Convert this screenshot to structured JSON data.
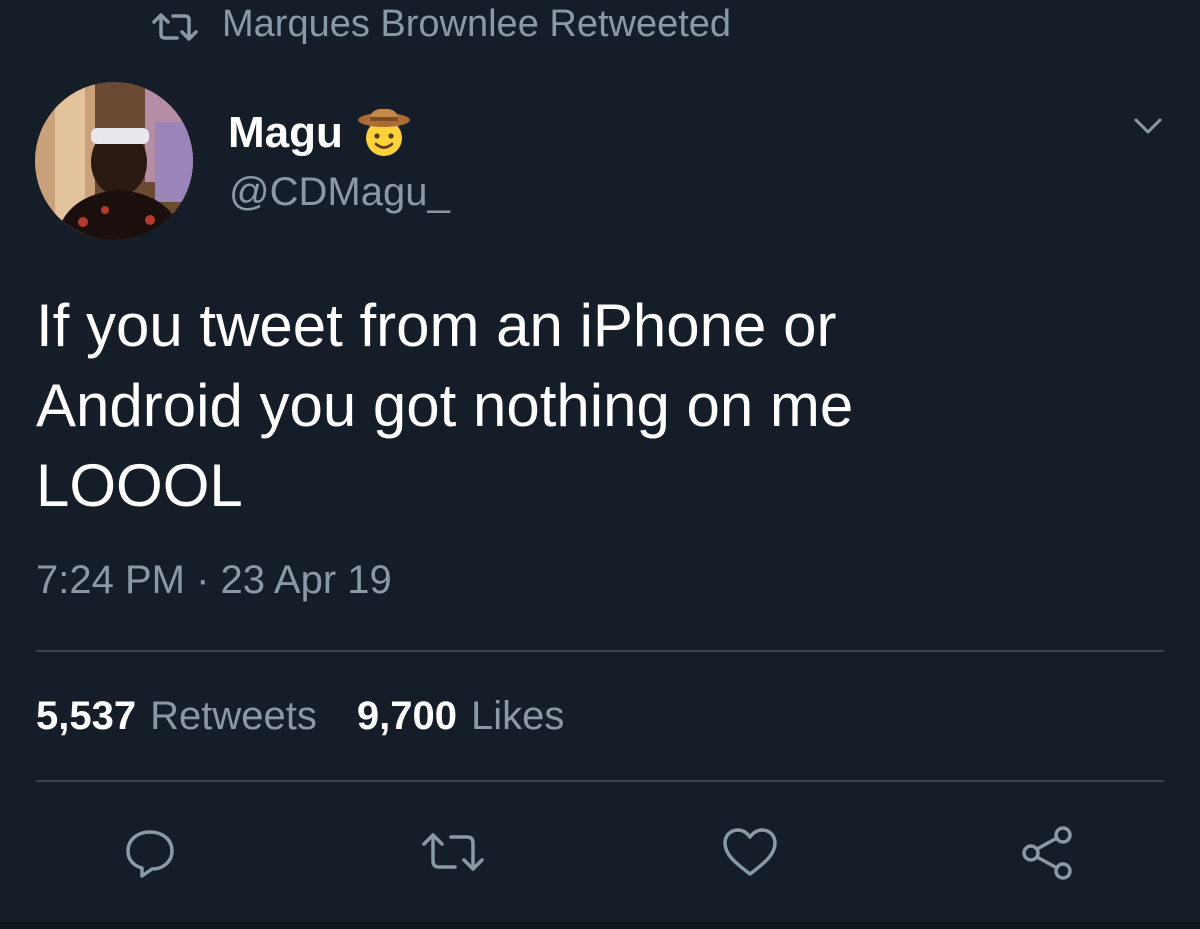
{
  "retweet_header": {
    "icon": "retweet-icon",
    "text": "Marques Brownlee Retweeted"
  },
  "author": {
    "name": "Magu",
    "emoji": "cowboy-hat-face-emoji",
    "handle": "@CDMagu_"
  },
  "tweet": {
    "text": "If you tweet from an iPhone or\nAndroid you got nothing on me\nLOOOL",
    "timestamp": "7:24 PM · 23 Apr 19"
  },
  "stats": {
    "retweets_count": "5,537",
    "retweets_label": "Retweets",
    "likes_count": "9,700",
    "likes_label": "Likes"
  },
  "actions": [
    {
      "name": "reply",
      "icon": "reply-icon"
    },
    {
      "name": "retweet",
      "icon": "retweet-icon"
    },
    {
      "name": "like",
      "icon": "heart-icon"
    },
    {
      "name": "share",
      "icon": "share-icon"
    }
  ],
  "colors": {
    "background": "#151d28",
    "primary_text": "#ffffff",
    "secondary_text": "#8b98a5",
    "divider": "#38444d"
  }
}
